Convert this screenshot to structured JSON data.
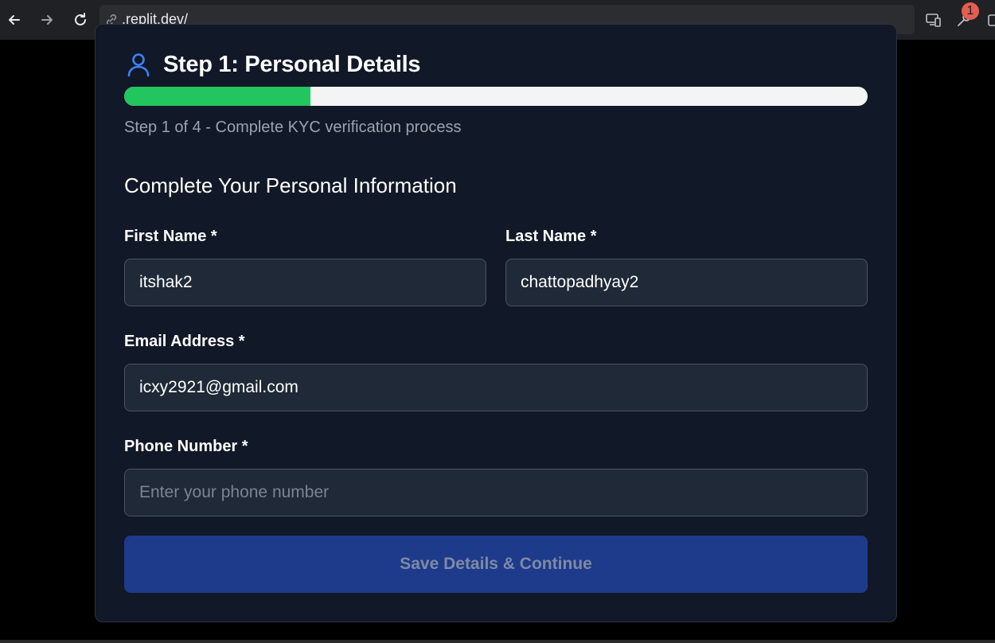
{
  "browser": {
    "url_prefix": ".replit.dev",
    "url_suffix": "/",
    "extensions_badge": "1"
  },
  "step": {
    "title": "Step 1: Personal Details",
    "progress_percent": 25,
    "subtitle": "Step 1 of 4 - Complete KYC verification process"
  },
  "form": {
    "heading": "Complete Your Personal Information",
    "first_name": {
      "label": "First Name *",
      "value": "itshak2"
    },
    "last_name": {
      "label": "Last Name *",
      "value": "chattopadhyay2"
    },
    "email": {
      "label": "Email Address *",
      "value": "icxy2921@gmail.com"
    },
    "phone": {
      "label": "Phone Number *",
      "value": "",
      "placeholder": "Enter your phone number"
    },
    "submit_label": "Save Details & Continue"
  },
  "colors": {
    "accent": "#3b82f6",
    "progress": "#22c55e",
    "button": "#1e3a8a"
  }
}
